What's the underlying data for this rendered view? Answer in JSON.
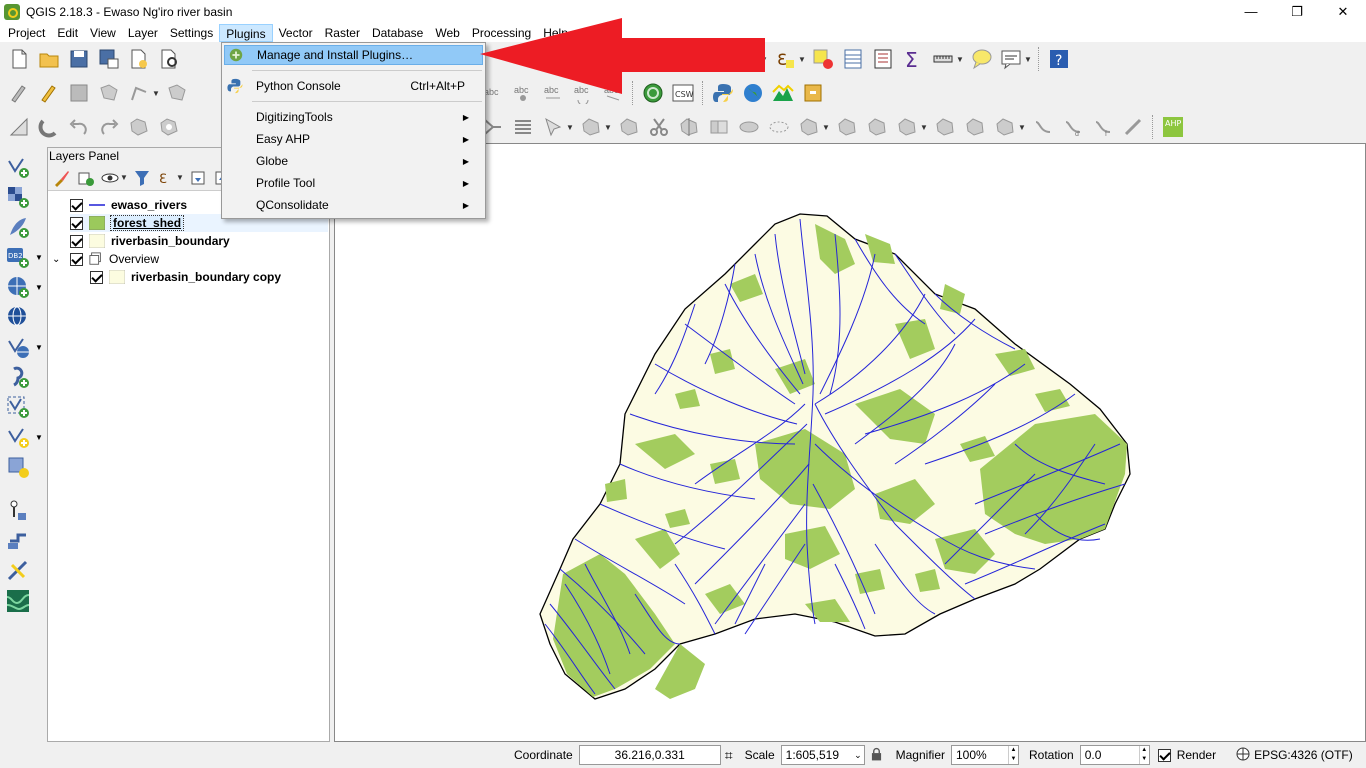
{
  "window": {
    "title": "QGIS 2.18.3 - Ewaso Ng'iro river basin",
    "minimize": "—",
    "restore": "❐",
    "close": "✕"
  },
  "menu": [
    "Project",
    "Edit",
    "View",
    "Layer",
    "Settings",
    "Plugins",
    "Vector",
    "Raster",
    "Database",
    "Web",
    "Processing",
    "Help"
  ],
  "active_menu": "Plugins",
  "plugins_menu": {
    "items": [
      {
        "label": "Manage and Install Plugins…",
        "shortcut": "",
        "submenu": false,
        "icon": "plugin-manager-icon",
        "highlighted": true
      },
      {
        "label": "Python Console",
        "shortcut": "Ctrl+Alt+P",
        "submenu": false,
        "icon": "python-icon",
        "highlighted": false
      },
      {
        "label": "DigitizingTools",
        "shortcut": "",
        "submenu": true
      },
      {
        "label": "Easy AHP",
        "shortcut": "",
        "submenu": true
      },
      {
        "label": "Globe",
        "shortcut": "",
        "submenu": true
      },
      {
        "label": "Profile Tool",
        "shortcut": "",
        "submenu": true
      },
      {
        "label": "QConsolidate",
        "shortcut": "",
        "submenu": true
      }
    ],
    "highlight_color": "#91c9f7"
  },
  "toolbar_labels": {
    "csw": "CSW",
    "ahp": "AHP"
  },
  "layers_panel": {
    "title": "Layers Panel",
    "layers": [
      {
        "name": "ewaso_rivers",
        "checked": true,
        "symbol": "line",
        "color": "#1f1fd6",
        "bold": true
      },
      {
        "name": "forest_shed",
        "checked": true,
        "symbol": "fill",
        "color": "#9bc95c",
        "bold": true,
        "selected": true
      },
      {
        "name": "riverbasin_boundary",
        "checked": true,
        "symbol": "fill",
        "color": "#fcfce0",
        "bold": true
      },
      {
        "name": "Overview",
        "checked": true,
        "symbol": "group",
        "bold": false,
        "expanded": true
      },
      {
        "name": "riverbasin_boundary copy",
        "checked": true,
        "symbol": "fill",
        "color": "#fcfce0",
        "bold": true,
        "indent": true
      }
    ]
  },
  "map": {
    "basin_fill": "#fcfbe3",
    "forest_fill": "#a3cc5e",
    "river_color": "#2525d8",
    "boundary_color": "#000000"
  },
  "status": {
    "coordinate_label": "Coordinate",
    "coordinate_value": "36.216,0.331",
    "scale_label": "Scale",
    "scale_value": "1:605,519",
    "magnifier_label": "Magnifier",
    "magnifier_value": "100%",
    "rotation_label": "Rotation",
    "rotation_value": "0.0",
    "render_label": "Render",
    "render_checked": true,
    "crs": "EPSG:4326 (OTF)"
  },
  "annotation": {
    "arrow_color": "#ed1c24"
  }
}
